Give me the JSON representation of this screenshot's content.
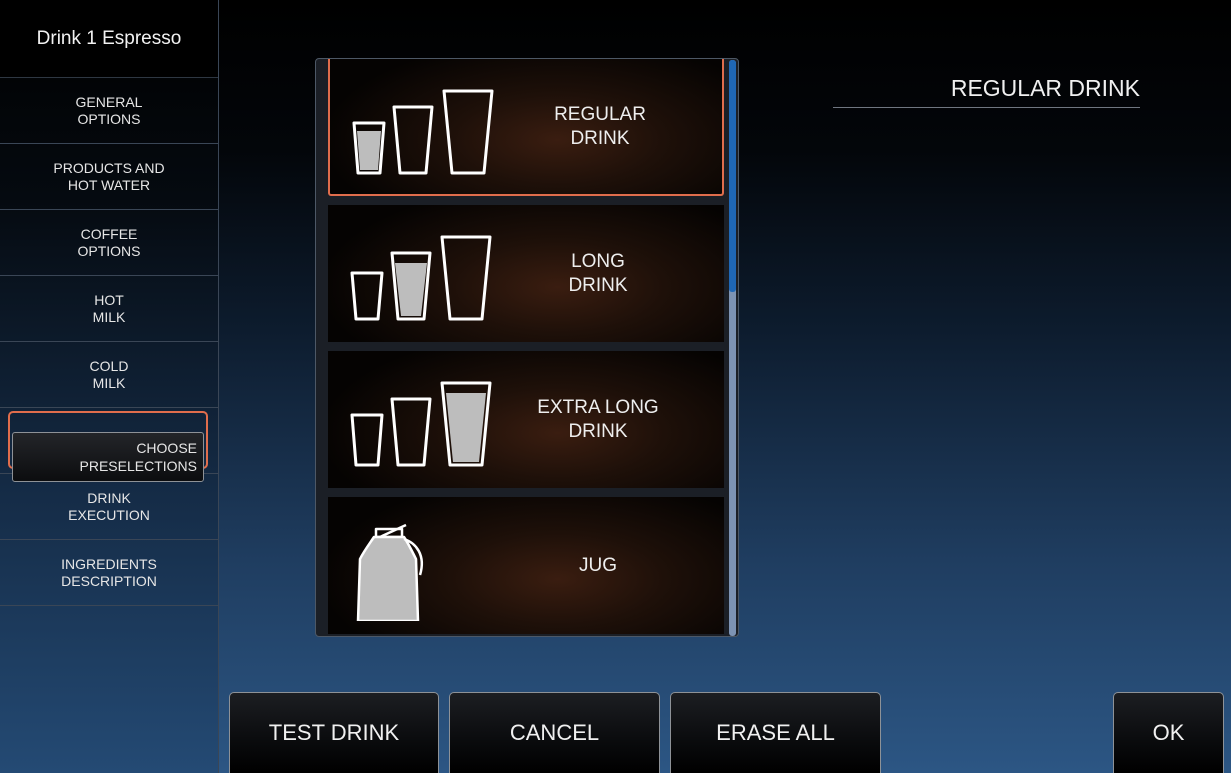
{
  "sidebar": {
    "title": "Drink 1 Espresso",
    "items": [
      {
        "label": "GENERAL\nOPTIONS"
      },
      {
        "label": "PRODUCTS AND\nHOT WATER"
      },
      {
        "label": "COFFEE\nOPTIONS"
      },
      {
        "label": "HOT\nMILK"
      },
      {
        "label": "COLD\nMILK"
      },
      {
        "label": "CHOOSE\nPRESELECTIONS",
        "selected": true
      },
      {
        "label": "DRINK\nEXECUTION"
      },
      {
        "label": "INGREDIENTS\nDESCRIPTION"
      }
    ]
  },
  "list": {
    "items": [
      {
        "label": "REGULAR\nDRINK",
        "icon": "small-cup-filled-icon",
        "selected": true
      },
      {
        "label": "LONG\nDRINK",
        "icon": "medium-cup-filled-icon"
      },
      {
        "label": "EXTRA LONG\nDRINK",
        "icon": "large-cup-filled-icon"
      },
      {
        "label": "JUG",
        "icon": "jug-icon"
      }
    ]
  },
  "detail": {
    "title": "REGULAR DRINK"
  },
  "buttons": {
    "test_drink": "TEST DRINK",
    "cancel": "CANCEL",
    "erase_all": "ERASE ALL",
    "ok": "OK"
  },
  "colors": {
    "selection_border": "#e06d4c",
    "scroll_thumb": "#1f67b5",
    "scroll_track": "#7d93b3"
  }
}
